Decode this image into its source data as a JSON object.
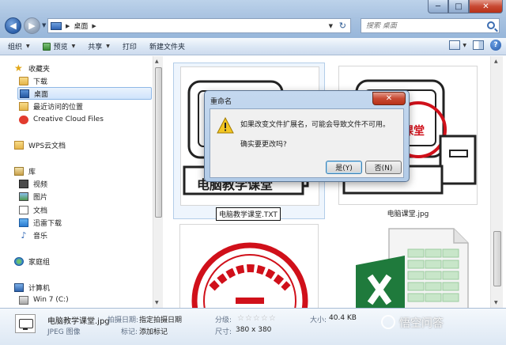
{
  "window": {
    "caption": {
      "min": "─",
      "max": "□",
      "close": "✕"
    }
  },
  "address": {
    "location": "桌面"
  },
  "search": {
    "placeholder": "搜索 桌面"
  },
  "commands": [
    {
      "label": "组织"
    },
    {
      "label": "预览"
    },
    {
      "label": "共享"
    },
    {
      "label": "打印"
    },
    {
      "label": "新建文件夹"
    }
  ],
  "sidebar": {
    "favorites": {
      "label": "收藏夹"
    },
    "favorite_items": [
      {
        "label": "下载"
      },
      {
        "label": "桌面"
      },
      {
        "label": "最近访问的位置"
      },
      {
        "label": "Creative Cloud Files"
      }
    ],
    "wps": {
      "label": "WPS云文档"
    },
    "libraries": {
      "label": "库"
    },
    "library_items": [
      {
        "label": "视频"
      },
      {
        "label": "图片"
      },
      {
        "label": "文档"
      },
      {
        "label": "迅雷下载"
      },
      {
        "label": "音乐"
      }
    ],
    "homegroup": {
      "label": "家庭组"
    },
    "computer": {
      "label": "计算机"
    },
    "drive": {
      "label": "Win 7 (C:)"
    }
  },
  "files": [
    {
      "label": "电脑教学课堂.TXT",
      "state": "renaming"
    },
    {
      "label": "电脑课堂.jpg"
    }
  ],
  "dialog": {
    "title": "重命名",
    "message1": "如果改变文件扩展名，可能会导致文件不可用。",
    "message2": "确实要更改吗?",
    "yes": "是(Y)",
    "no": "否(N)",
    "close": "✕"
  },
  "details": {
    "filename": "电脑教学课堂.jpg",
    "filetype": "JPEG 图像",
    "date_key": "拍摄日期:",
    "date_val": "指定拍摄日期",
    "tag_key": "标记:",
    "tag_val": "添加标记",
    "rating_key": "分级:",
    "stars": "☆☆☆☆☆",
    "dims_key": "尺寸:",
    "dims_val": "380 x 380",
    "size_key": "大小:",
    "size_val": "40.4 KB"
  },
  "watermark": {
    "text": "悟空问答"
  },
  "colors": {
    "aero": "#a9c3e1",
    "selection": "#cfe3fb",
    "warning": "#f3c623",
    "excel": "#1f7a3c",
    "stamp": "#d0101a"
  }
}
